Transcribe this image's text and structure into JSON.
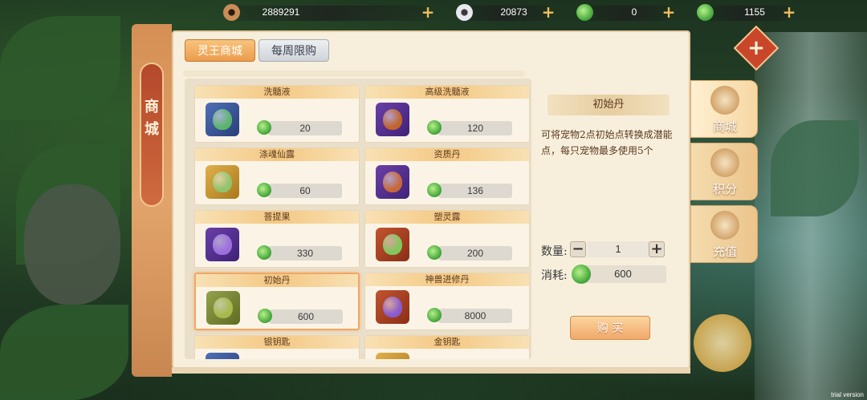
{
  "currencies": [
    {
      "icon": "copper-coin-icon",
      "value": "2889291"
    },
    {
      "icon": "silver-coin-icon",
      "value": "20873"
    },
    {
      "icon": "jade-coin-icon",
      "value": "0"
    },
    {
      "icon": "jade-coin-icon",
      "value": "1155"
    }
  ],
  "currency_plus": "+",
  "left_tab": {
    "label": "商\n城"
  },
  "tabs": [
    {
      "label": "灵王商城",
      "active": true
    },
    {
      "label": "每周限购",
      "active": false
    }
  ],
  "items": [
    {
      "name": "洗髓液",
      "price": "20",
      "pic": "pic-blue",
      "obj": "#5ab56c"
    },
    {
      "name": "高级洗髓液",
      "price": "120",
      "pic": "pic-purple",
      "obj": "#c2642b"
    },
    {
      "name": "涤魂仙露",
      "price": "60",
      "pic": "pic-gold",
      "obj": "#8fc46a"
    },
    {
      "name": "资质丹",
      "price": "136",
      "pic": "pic-purple",
      "obj": "#c7683a"
    },
    {
      "name": "菩提果",
      "price": "330",
      "pic": "pic-purple",
      "obj": "#9c6fe0"
    },
    {
      "name": "塑灵露",
      "price": "200",
      "pic": "pic-red",
      "obj": "#7fc85a"
    },
    {
      "name": "初始丹",
      "price": "600",
      "pic": "pic-olive",
      "obj": "#a8b84a",
      "selected": true
    },
    {
      "name": "神兽进修丹",
      "price": "8000",
      "pic": "pic-red",
      "obj": "#8a5ad0"
    },
    {
      "name": "银钥匙",
      "price": "",
      "pic": "pic-blue",
      "obj": "#cccccc"
    },
    {
      "name": "金钥匙",
      "price": "",
      "pic": "pic-gold",
      "obj": "#e0b04a"
    }
  ],
  "detail": {
    "title": "初始丹",
    "description": "可将宠物2点初始点转换成潜能点，每只宠物最多使用5个",
    "quantity_label": "数量:",
    "minus": "−",
    "quantity": "1",
    "plus": "+",
    "cost_label": "消耗:",
    "cost": "600",
    "buy_label": "购 买"
  },
  "side_nav": [
    {
      "label": "商城",
      "icon": "shop-icon",
      "active": true
    },
    {
      "label": "积分",
      "icon": "points-icon",
      "active": false
    },
    {
      "label": "充值",
      "icon": "recharge-icon",
      "active": false
    }
  ],
  "close_label": "+",
  "watermark": "trial version"
}
